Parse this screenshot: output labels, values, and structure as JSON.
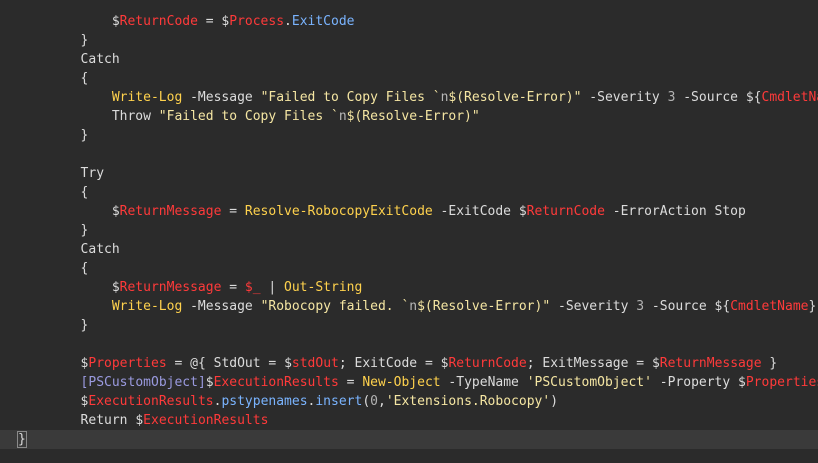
{
  "colors": {
    "background": "#2b2b2b",
    "current_line": "#3a3a3a",
    "default": "#dcdcdc",
    "variable": "#ff3a3a",
    "function": "#ffd24d",
    "string": "#f5e6a3",
    "number": "#b3b3b3",
    "type": "#9a9adf",
    "property": "#7ab4ff",
    "escape": "#b8b8b8"
  },
  "lines": [
    {
      "indent": 12,
      "tokens": [
        [
          "$",
          "default"
        ],
        [
          "ReturnCode",
          "variable"
        ],
        [
          " = ",
          "default"
        ],
        [
          "$",
          "default"
        ],
        [
          "Process",
          "variable"
        ],
        [
          ".",
          "default"
        ],
        [
          "ExitCode",
          "property"
        ]
      ]
    },
    {
      "indent": 8,
      "tokens": [
        [
          "}",
          "default"
        ]
      ]
    },
    {
      "indent": 8,
      "tokens": [
        [
          "Catch",
          "default"
        ]
      ]
    },
    {
      "indent": 8,
      "tokens": [
        [
          "{",
          "default"
        ]
      ]
    },
    {
      "indent": 12,
      "tokens": [
        [
          "Write-Log",
          "function"
        ],
        [
          " -Message ",
          "default"
        ],
        [
          "\"Failed to Copy Files `",
          "string"
        ],
        [
          "n",
          "escape"
        ],
        [
          "$(Resolve-Error)\"",
          "string"
        ],
        [
          " -Severity ",
          "default"
        ],
        [
          "3",
          "number"
        ],
        [
          " -Source ",
          "default"
        ],
        [
          "${",
          "default"
        ],
        [
          "CmdletName",
          "variable"
        ],
        [
          "}",
          "default"
        ]
      ]
    },
    {
      "indent": 12,
      "tokens": [
        [
          "Throw ",
          "default"
        ],
        [
          "\"Failed to Copy Files `",
          "string"
        ],
        [
          "n",
          "escape"
        ],
        [
          "$(Resolve-Error)\"",
          "string"
        ]
      ]
    },
    {
      "indent": 8,
      "tokens": [
        [
          "}",
          "default"
        ]
      ]
    },
    {
      "indent": 0,
      "tokens": []
    },
    {
      "indent": 8,
      "tokens": [
        [
          "Try",
          "default"
        ]
      ]
    },
    {
      "indent": 8,
      "tokens": [
        [
          "{",
          "default"
        ]
      ]
    },
    {
      "indent": 12,
      "tokens": [
        [
          "$",
          "default"
        ],
        [
          "ReturnMessage",
          "variable"
        ],
        [
          " = ",
          "default"
        ],
        [
          "Resolve-RobocopyExitCode",
          "function"
        ],
        [
          " -ExitCode ",
          "default"
        ],
        [
          "$",
          "default"
        ],
        [
          "ReturnCode",
          "variable"
        ],
        [
          " -ErrorAction Stop",
          "default"
        ]
      ]
    },
    {
      "indent": 8,
      "tokens": [
        [
          "}",
          "default"
        ]
      ]
    },
    {
      "indent": 8,
      "tokens": [
        [
          "Catch",
          "default"
        ]
      ]
    },
    {
      "indent": 8,
      "tokens": [
        [
          "{",
          "default"
        ]
      ]
    },
    {
      "indent": 12,
      "tokens": [
        [
          "$",
          "default"
        ],
        [
          "ReturnMessage",
          "variable"
        ],
        [
          " = ",
          "default"
        ],
        [
          "$_",
          "variable"
        ],
        [
          " | ",
          "default"
        ],
        [
          "Out-String",
          "function"
        ]
      ]
    },
    {
      "indent": 12,
      "tokens": [
        [
          "Write-Log",
          "function"
        ],
        [
          " -Message ",
          "default"
        ],
        [
          "\"Robocopy failed. `",
          "string"
        ],
        [
          "n",
          "escape"
        ],
        [
          "$(Resolve-Error)\"",
          "string"
        ],
        [
          " -Severity ",
          "default"
        ],
        [
          "3",
          "number"
        ],
        [
          " -Source ",
          "default"
        ],
        [
          "${",
          "default"
        ],
        [
          "CmdletName",
          "variable"
        ],
        [
          "}",
          "default"
        ]
      ]
    },
    {
      "indent": 8,
      "tokens": [
        [
          "}",
          "default"
        ]
      ]
    },
    {
      "indent": 0,
      "tokens": []
    },
    {
      "indent": 8,
      "tokens": [
        [
          "$",
          "default"
        ],
        [
          "Properties",
          "variable"
        ],
        [
          " = @{ StdOut = ",
          "default"
        ],
        [
          "$",
          "default"
        ],
        [
          "stdOut",
          "variable"
        ],
        [
          "; ExitCode = ",
          "default"
        ],
        [
          "$",
          "default"
        ],
        [
          "ReturnCode",
          "variable"
        ],
        [
          "; ExitMessage = ",
          "default"
        ],
        [
          "$",
          "default"
        ],
        [
          "ReturnMessage",
          "variable"
        ],
        [
          " }",
          "default"
        ]
      ]
    },
    {
      "indent": 8,
      "tokens": [
        [
          "[PSCustomObject]",
          "type"
        ],
        [
          "$",
          "default"
        ],
        [
          "ExecutionResults",
          "variable"
        ],
        [
          " = ",
          "default"
        ],
        [
          "New-Object",
          "function"
        ],
        [
          " -TypeName ",
          "default"
        ],
        [
          "'PSCustomObject'",
          "string"
        ],
        [
          " -Property ",
          "default"
        ],
        [
          "$",
          "default"
        ],
        [
          "Properties",
          "variable"
        ]
      ]
    },
    {
      "indent": 8,
      "tokens": [
        [
          "$",
          "default"
        ],
        [
          "ExecutionResults",
          "variable"
        ],
        [
          ".",
          "default"
        ],
        [
          "pstypenames",
          "property"
        ],
        [
          ".",
          "default"
        ],
        [
          "insert",
          "property"
        ],
        [
          "(",
          "default"
        ],
        [
          "0",
          "number"
        ],
        [
          ",",
          "default"
        ],
        [
          "'Extensions.Robocopy'",
          "string"
        ],
        [
          ")",
          "default"
        ]
      ]
    },
    {
      "indent": 8,
      "tokens": [
        [
          "Return ",
          "default"
        ],
        [
          "$",
          "default"
        ],
        [
          "ExecutionResults",
          "variable"
        ]
      ]
    },
    {
      "indent": 0,
      "current": true,
      "tokens": [
        [
          "}",
          "default"
        ]
      ]
    }
  ]
}
